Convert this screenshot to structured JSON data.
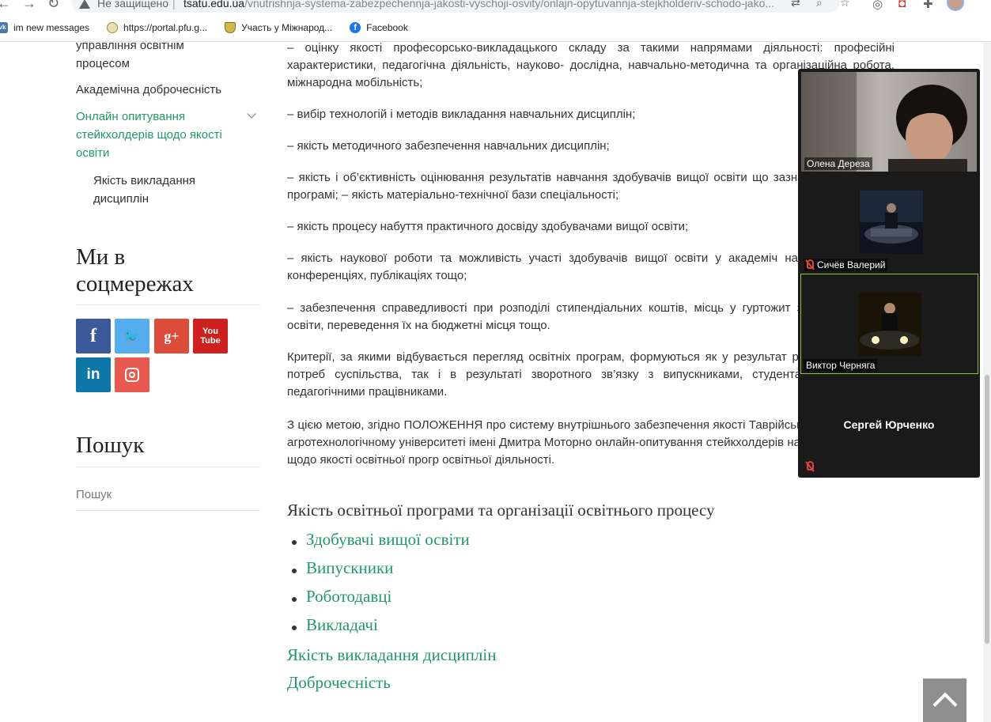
{
  "browser": {
    "security_label": "Не защищено",
    "url_domain": "tsatu.edu.ua",
    "url_path": "/vnutrishnja-systema-zabezpechennja-jakosti-vyschoji-osvity/onlajn-opytuvannja-stejkholderiv-schodo-jako...",
    "bookmarks": [
      {
        "label": "im new messages",
        "icon": "vk-icon"
      },
      {
        "label": "https://portal.pfu.g...",
        "icon": "pfu-icon"
      },
      {
        "label": "Участь у Міжнарод...",
        "icon": "emblem-icon"
      },
      {
        "label": "Facebook",
        "icon": "facebook-icon"
      }
    ]
  },
  "sidebar": {
    "nav_top_partial_1": "управління освітнім",
    "nav_top_partial_2": "процесом",
    "integrity": "Академічна доброчесність",
    "survey_line1": "Онлайн опитування",
    "survey_line2": "стейкхолдерів щодо якості",
    "survey_line3": "освіти",
    "sub_line1": "Якість викладання",
    "sub_line2": "дисциплін",
    "social_title_line1": "Ми в",
    "social_title_line2": "соцмережах",
    "social": [
      {
        "name": "facebook",
        "glyph": "f"
      },
      {
        "name": "twitter",
        "glyph": "🐦"
      },
      {
        "name": "google-plus",
        "glyph": "g+"
      },
      {
        "name": "youtube",
        "glyph": "You\nTube"
      },
      {
        "name": "linkedin",
        "glyph": "in"
      },
      {
        "name": "instagram",
        "glyph": ""
      }
    ],
    "search_title": "Пошук",
    "search_placeholder": "Пошук"
  },
  "content": {
    "p1": "– оцінку якості професорсько-викладацького складу за такими напрямами діяльності: професійні характеристики, педагогічна діяльність, науково- дослідна, навчально-методична та організаційна робота, міжнародна мобільність;",
    "p2": "– вибір технологій і методів викладання навчальних дисциплін;",
    "p3": "– якість методичного забезпечення навчальних дисциплін;",
    "p4": "– якість і об’єктивність оцінювання результатів навчання здобувачів вищої освіти що зазначених в освітній програмі; – якість матеріально-технічної бази спеціальності;",
    "p5": "– якість процесу набуття практичного досвіду здобувачами вищої освіти;",
    "p6": "– якість наукової роботи та можливість участі здобувачів вищої освіти у академіч наукових проектах, конференціях, публікаціях тощо;",
    "p7": "– забезпечення справедливості при розподілі стипендіальних коштів, місць у гуртожит здобувачів вищої освіти, переведення їх на бюджетні місця тощо.",
    "p8": "Критерії, за якими відбувається перегляд освітніх програм, формуються як у результат розвитку галузі та потреб суспільства, так і в результаті зворотного зв’язку з випускниками, студентами та науково-педагогічними працівниками.",
    "p9": "З цією метою, згідно ПОЛОЖЕННЯ про систему внутрішнього забезпечення якості Таврійському державному агротехнологічному університеті імені Дмитра Моторно онлайн-опитування стейкхолдерів на веб-сайті ТДАТУ щодо якості освітньої прогр освітньої діяльності.",
    "heading": "Якість освітньої програми та організації освітнього процесу",
    "links": [
      "Здобувачі вищої освіти",
      "Випускники",
      "Роботодавці",
      "Викладачі"
    ],
    "link_teaching": "Якість викладання дисциплін",
    "link_integrity": "Доброчесність"
  },
  "zoom": {
    "participants": [
      {
        "name": "Олена Дереза",
        "muted": false
      },
      {
        "name": "Сичёв Валерий",
        "muted": true
      },
      {
        "name": "Виктор Черняга",
        "muted": false,
        "active_speaker": true
      },
      {
        "name": "Сергей Юрченко",
        "muted": true
      }
    ]
  },
  "colors": {
    "accent": "#1f9a66",
    "zoom_bg": "#1a1a1a",
    "active_border": "#8bc34a"
  }
}
